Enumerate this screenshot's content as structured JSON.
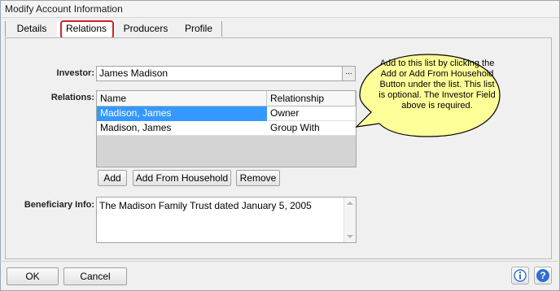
{
  "window": {
    "title": "Modify Account Information"
  },
  "tabs": [
    {
      "label": "Details"
    },
    {
      "label": "Relations",
      "active": true
    },
    {
      "label": "Producers"
    },
    {
      "label": "Profile"
    }
  ],
  "investor": {
    "label": "Investor:",
    "value": "James Madison",
    "browse_label": "..."
  },
  "relations": {
    "label": "Relations:",
    "columns": [
      "Name",
      "Relationship"
    ],
    "rows": [
      {
        "name": "Madison, James",
        "relationship": "Owner",
        "selected": true
      },
      {
        "name": "Madison, James",
        "relationship": "Group With",
        "selected": false
      }
    ],
    "buttons": {
      "add": "Add",
      "add_from_household": "Add From Household",
      "remove": "Remove"
    }
  },
  "beneficiary": {
    "label": "Beneficiary Info:",
    "value": "The Madison Family Trust dated January 5, 2005"
  },
  "callout": {
    "text": "Add to this list by clicking the Add or Add From Household Button under the list.  This list is optional.  The Investor Field above is required."
  },
  "footer": {
    "ok": "OK",
    "cancel": "Cancel"
  },
  "colors": {
    "selection": "#3399ff",
    "highlight_border": "#d4202b",
    "callout_fill": "#ffff99",
    "help_blue": "#2f6fd0"
  }
}
